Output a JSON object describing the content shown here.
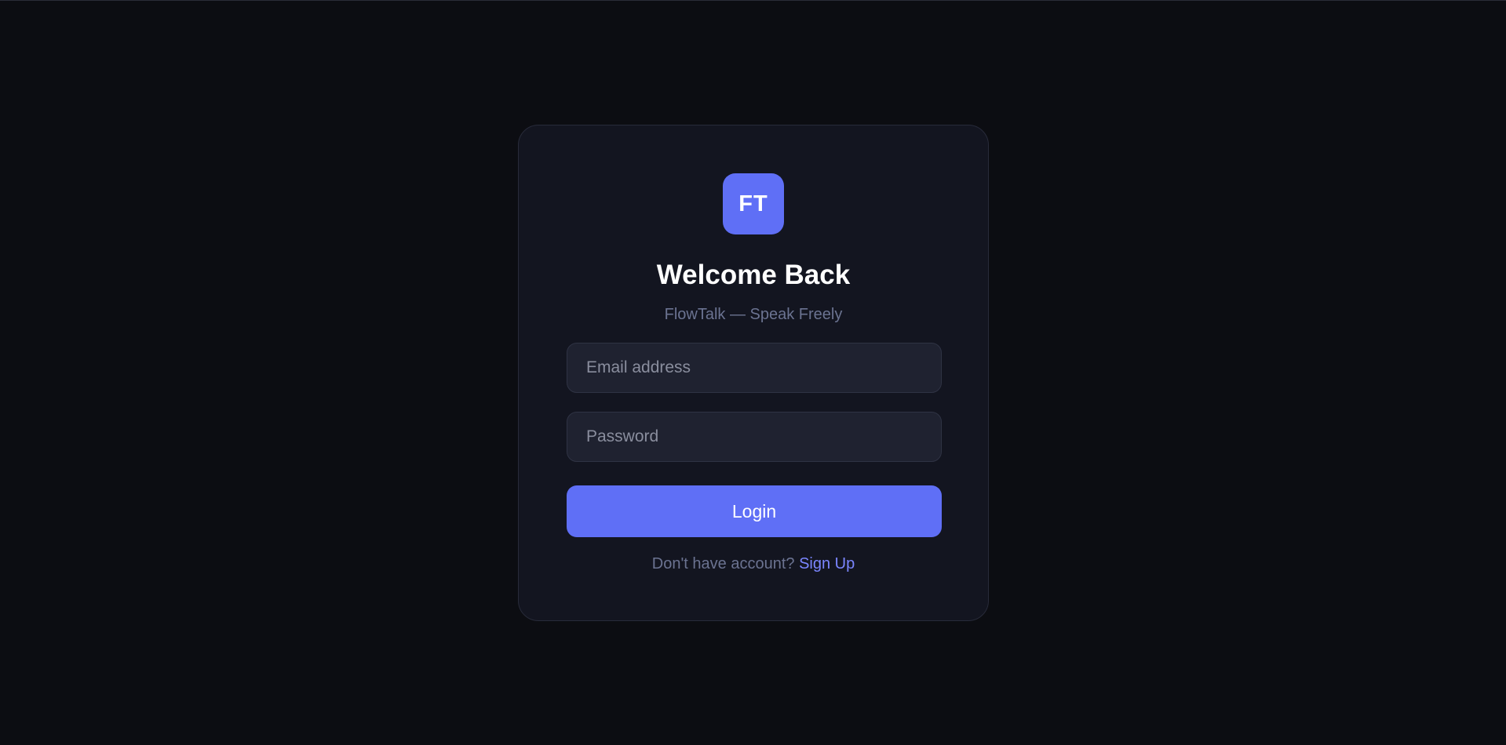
{
  "logo": {
    "initials": "FT"
  },
  "login": {
    "title": "Welcome Back",
    "subtitle": "FlowTalk — Speak Freely",
    "email": {
      "placeholder": "Email address",
      "value": ""
    },
    "password": {
      "placeholder": "Password",
      "value": ""
    },
    "submit_label": "Login",
    "signup_prompt": "Don't have account?",
    "signup_link": "Sign Up"
  },
  "colors": {
    "background": "#0c0d12",
    "card": "#131520",
    "accent": "#5f6ff6",
    "link": "#7b86ff",
    "muted_text": "#6b7391"
  }
}
